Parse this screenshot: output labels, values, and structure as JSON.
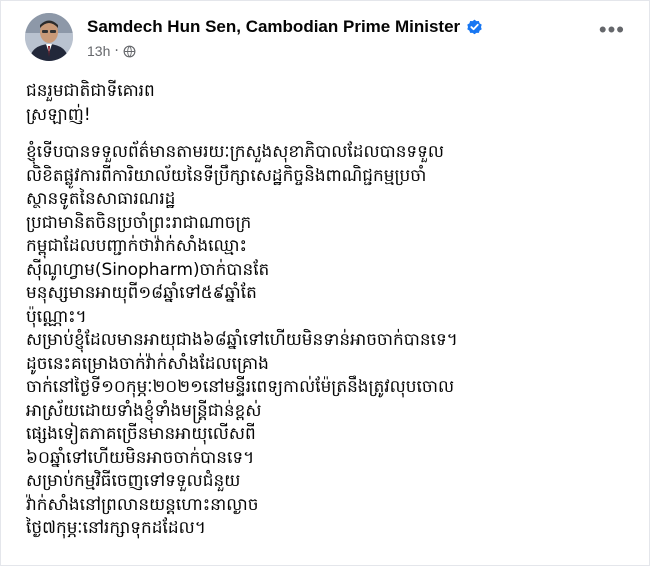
{
  "post": {
    "author": "Samdech Hun Sen, Cambodian Prime Minister",
    "time": "13h",
    "separator": "·",
    "more_label": "•••",
    "icons": {
      "verified": "verified-badge-icon",
      "audience": "globe-icon",
      "more": "more-options-icon"
    },
    "colors": {
      "verified": "#1877f2",
      "secondary_text": "#65676b"
    },
    "greeting": [
      "ជនរួមជាតិជាទីគោរព",
      "ស្រឡាញ់!"
    ],
    "body": [
      "ខ្ញុំទើបបានទទួលព័ត៌មានតាមរយៈក្រសួងសុខាភិបាលដែលបានទទួល",
      "លិខិតផ្លូវការពីការិយាល័យនៃទីប្រឹក្សាសេដ្ឋកិច្ចនិងពាណិជ្ជកម្មប្រចាំ",
      "ស្ថានទូតនៃសាធារណរដ្ឋ",
      "ប្រជាមានិតចិនប្រចាំព្រះរាជាណាចក្រ",
      "កម្ពុជាដែលបញ្ជាក់ថាវ៉ាក់សាំងឈ្មោះ",
      "ស៊ីណូហ្វាម(Sinopharm)ចាក់បានតែ",
      "មនុស្សមានអាយុពី១៨ឆ្នាំទៅ៥៩ឆ្នាំតែ",
      "ប៉ុណ្ណោះ។",
      "សម្រាប់ខ្ញុំដែលមានអាយុជាង៦៨ឆ្នាំទៅហើយមិនទាន់អាចចាក់បានទេ។",
      "ដូចនេះគម្រោងចាក់វ៉ាក់សាំងដែលគ្រោង",
      "ចាក់នៅថ្ងៃទី១០កុម្ភៈ២០២១នៅមន្ទីរពេទ្យកាល់ម៉ែត្រនឹងត្រូវលុបចោល",
      "អាស្រ័យដោយទាំងខ្ញុំទាំងមន្ត្រីជាន់ខ្ពស់",
      "ផ្សេងទៀតភាគច្រើនមានអាយុលើសពី",
      "៦០ឆ្នាំទៅហើយមិនអាចចាក់បានទេ។",
      "សម្រាប់កម្មវិធីចេញទៅទទួលជំនួយ",
      "វ៉ាក់សាំងនៅព្រលានយន្តហោះនាល្ងាច",
      "ថ្ងៃ៧កុម្ភៈនៅរក្សាទុកដដែល។"
    ]
  }
}
